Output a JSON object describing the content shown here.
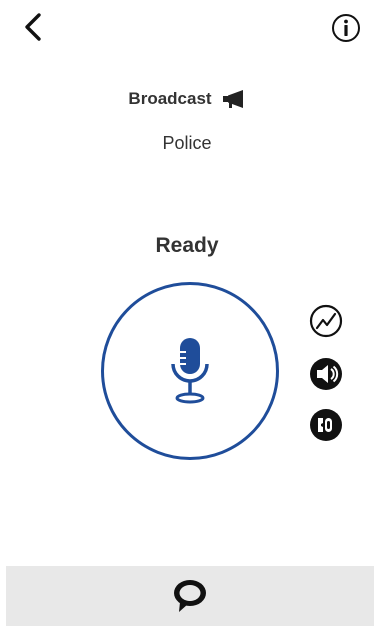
{
  "header": {
    "back_icon": "chevron-left-icon",
    "info_icon": "info-circle-icon"
  },
  "call": {
    "mode_label": "Broadcast",
    "mode_icon": "megaphone-icon",
    "group_name": "Police",
    "status": "Ready"
  },
  "ptt": {
    "icon": "microphone-icon",
    "accent_color": "#1f4d9a"
  },
  "side_controls": [
    {
      "icon": "signal-strength-icon"
    },
    {
      "icon": "speaker-icon"
    },
    {
      "icon": "earpiece-icon"
    }
  ],
  "footer": {
    "chat_icon": "chat-bubble-icon",
    "background": "#e8e8e8"
  }
}
